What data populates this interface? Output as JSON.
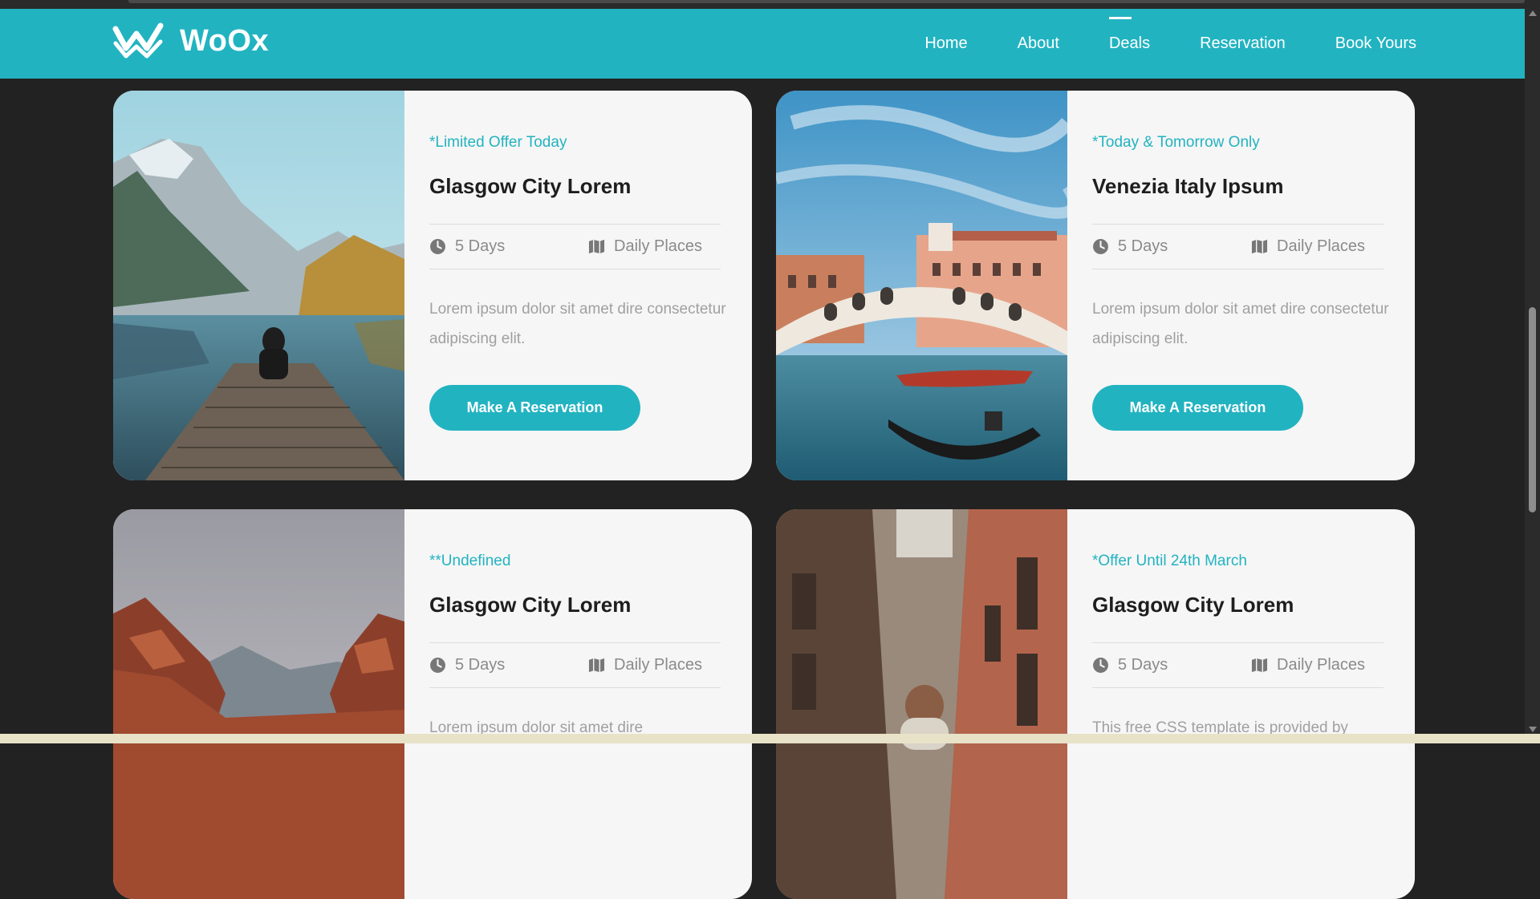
{
  "brand": {
    "name": "WoOx",
    "accent": "#22b3c1"
  },
  "nav": [
    {
      "label": "Home",
      "active": false
    },
    {
      "label": "About",
      "active": false
    },
    {
      "label": "Deals",
      "active": true
    },
    {
      "label": "Reservation",
      "active": false
    },
    {
      "label": "Book Yours",
      "active": false
    }
  ],
  "deals": [
    {
      "image": "mountain lake with person on wooden dock",
      "tag": "*Limited Offer Today",
      "title": "Glasgow City Lorem",
      "duration_icon": "clock-icon",
      "duration": "5 Days",
      "places_icon": "map-icon",
      "places": "Daily Places",
      "description": "Lorem ipsum dolor sit amet dire consectetur adipiscing elit.",
      "button": "Make A Reservation"
    },
    {
      "image": "Venice Rialto bridge with gondola",
      "tag": "*Today & Tomorrow Only",
      "title": "Venezia Italy Ipsum",
      "duration_icon": "clock-icon",
      "duration": "5 Days",
      "places_icon": "map-icon",
      "places": "Daily Places",
      "description": "Lorem ipsum dolor sit amet dire consectetur adipiscing elit.",
      "button": "Make A Reservation"
    },
    {
      "image": "red rocky canyon with mountains",
      "tag": "**Undefined",
      "title": "Glasgow City Lorem",
      "duration_icon": "clock-icon",
      "duration": "5 Days",
      "places_icon": "map-icon",
      "places": "Daily Places",
      "description": "Lorem ipsum dolor sit amet dire"
    },
    {
      "image": "narrow old town alley with person",
      "tag": "*Offer Until 24th March",
      "title": "Glasgow City Lorem",
      "duration_icon": "clock-icon",
      "duration": "5 Days",
      "places_icon": "map-icon",
      "places": "Daily Places",
      "description": "This free CSS template is provided by"
    }
  ]
}
